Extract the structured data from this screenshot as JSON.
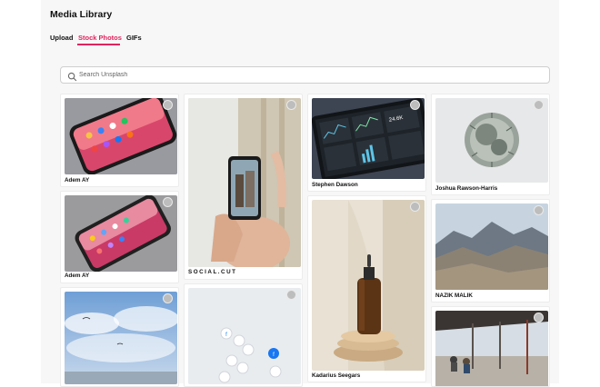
{
  "header": {
    "title": "Media Library"
  },
  "tabs": [
    {
      "label": "Upload",
      "active": false
    },
    {
      "label": "Stock Photos",
      "active": true
    },
    {
      "label": "GIFs",
      "active": false
    }
  ],
  "search": {
    "placeholder": "Search Unsplash",
    "value": ""
  },
  "accent_color": "#e0245e",
  "photos": [
    {
      "credit": "Adem AY",
      "subject": "iPhone home screen on fabric"
    },
    {
      "credit": "Adem AY",
      "subject": "iPhone on grey fabric"
    },
    {
      "credit": "",
      "subject": "Cloudy sky with paragliders"
    },
    {
      "credit": "SOCIAL.CUT",
      "subject": "Hand holding phone taking photo"
    },
    {
      "credit": "",
      "subject": "Social media icon buttons"
    },
    {
      "credit": "Stephen Dawson",
      "subject": "Analytics dashboard on tablet"
    },
    {
      "credit": "Kadarius Seegars",
      "subject": "Dropper bottle on wooden stand"
    },
    {
      "credit": "Joshua Rawson-Harris",
      "subject": "Tiny planet panorama"
    },
    {
      "credit": "NAZIK MALIK",
      "subject": "Mountain landscape"
    },
    {
      "credit": "",
      "subject": "Seaside terrace with people"
    }
  ]
}
